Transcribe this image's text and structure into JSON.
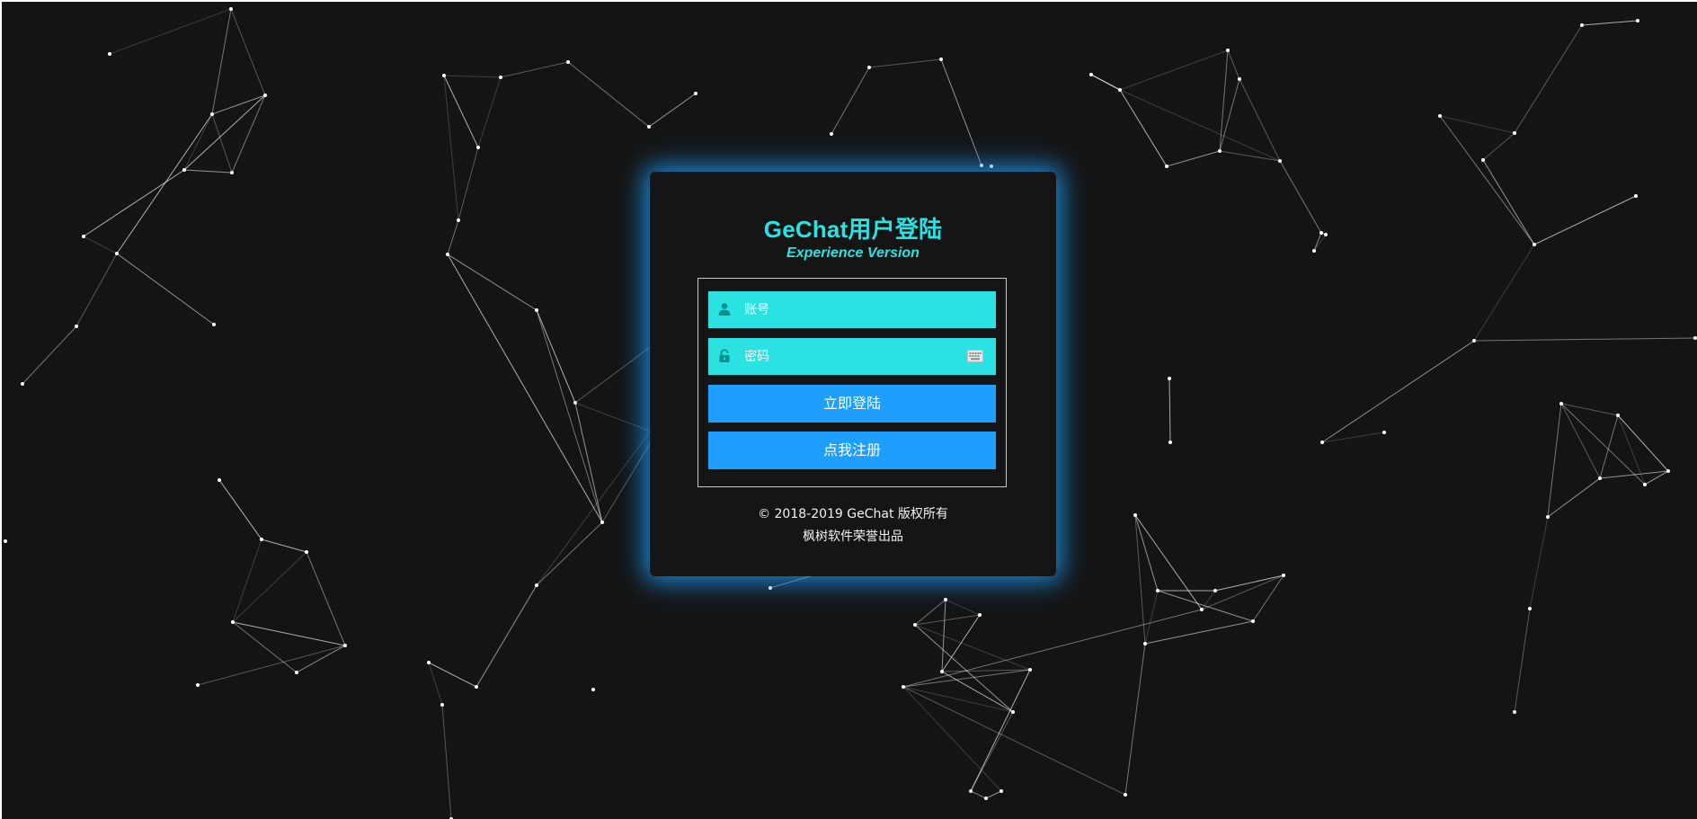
{
  "login": {
    "title": "GeChat用户登陆",
    "subtitle": "Experience Version",
    "username_placeholder": "账号",
    "password_placeholder": "密码",
    "login_button": "立即登陆",
    "register_button": "点我注册",
    "copyright": "© 2018-2019 GeChat 版权所有",
    "producer": "枫树软件荣誉出品"
  },
  "colors": {
    "background": "#141414",
    "accent_cyan": "#2ae2e2",
    "button_blue": "#1e9fff",
    "glow": "#1ea0ff"
  },
  "icons": {
    "username": "user-icon",
    "password": "lock-icon",
    "keyboard": "keyboard-icon"
  }
}
